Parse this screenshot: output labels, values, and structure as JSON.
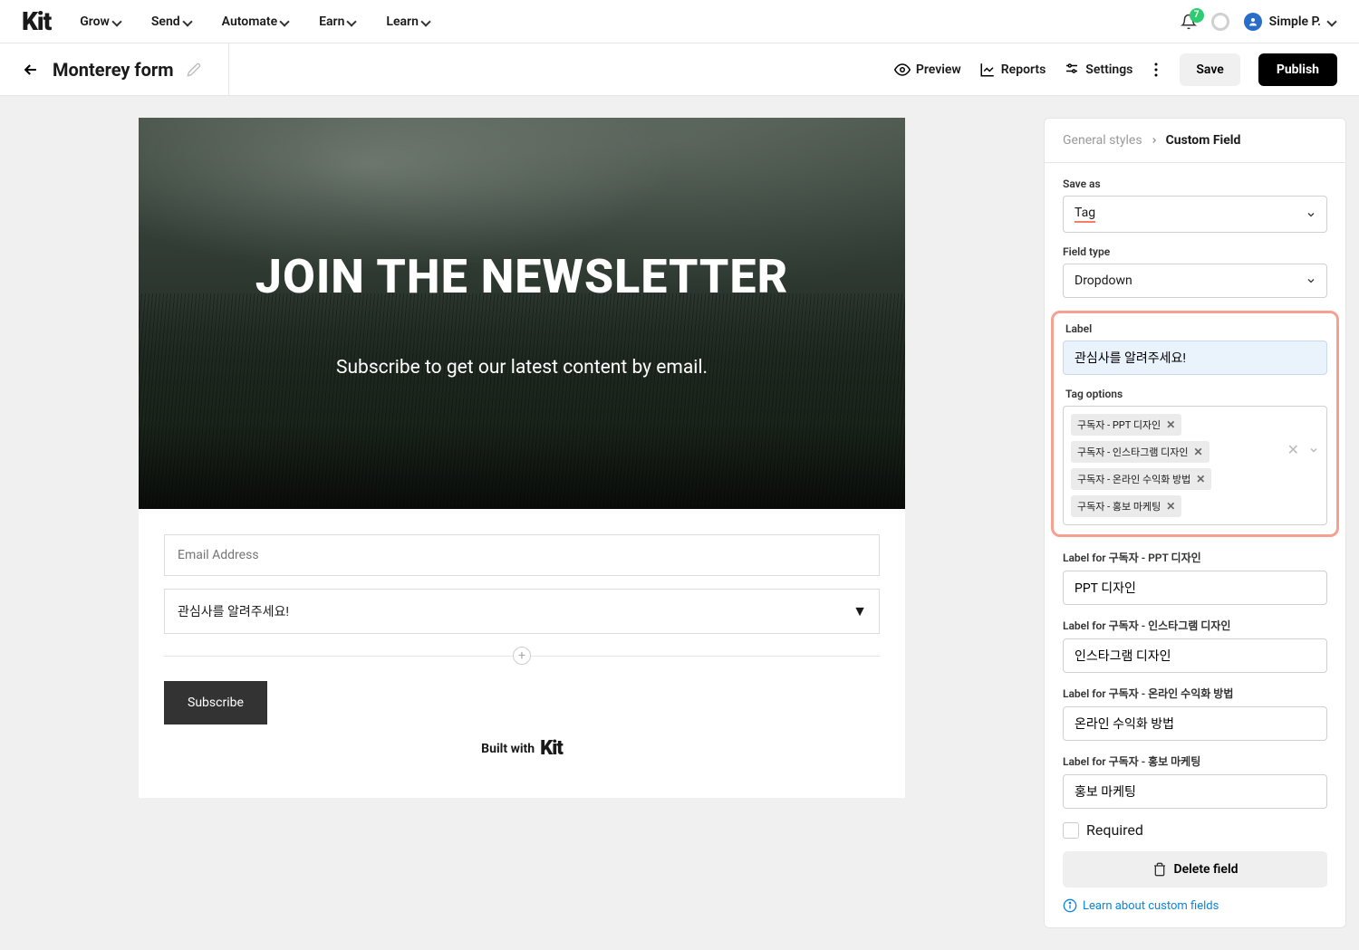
{
  "nav": {
    "logo": "Kit",
    "items": [
      "Grow",
      "Send",
      "Automate",
      "Earn",
      "Learn"
    ],
    "badge": "7",
    "user": "Simple P."
  },
  "subnav": {
    "title": "Monterey form",
    "preview": "Preview",
    "reports": "Reports",
    "settings": "Settings",
    "save": "Save",
    "publish": "Publish"
  },
  "hero": {
    "title": "JOIN THE NEWSLETTER",
    "subtitle": "Subscribe to get our latest content by email."
  },
  "form": {
    "email_placeholder": "Email Address",
    "dropdown_label": "관심사를 알려주세요!",
    "subscribe": "Subscribe",
    "builtwith": "Built with",
    "builtwith_brand": "Kit"
  },
  "panel": {
    "breadcrumb_prev": "General styles",
    "breadcrumb_current": "Custom Field",
    "save_as_label": "Save as",
    "save_as_value": "Tag",
    "field_type_label": "Field type",
    "field_type_value": "Dropdown",
    "label_label": "Label",
    "label_value": "관심사를 알려주세요!",
    "tag_options_label": "Tag options",
    "tags": [
      "구독자 - PPT 디자인",
      "구독자 - 인스타그램 디자인",
      "구독자 - 온라인 수익화 방법",
      "구독자 - 홍보 마케팅"
    ],
    "label_for_1_label": "Label for 구독자 - PPT 디자인",
    "label_for_1_value": "PPT 디자인",
    "label_for_2_label": "Label for 구독자 - 인스타그램 디자인",
    "label_for_2_value": "인스타그램 디자인",
    "label_for_3_label": "Label for 구독자 - 온라인 수익화 방법",
    "label_for_3_value": "온라인 수익화 방법",
    "label_for_4_label": "Label for 구독자 - 홍보 마케팅",
    "label_for_4_value": "홍보 마케팅",
    "required": "Required",
    "delete": "Delete field",
    "learn": "Learn about custom fields"
  }
}
